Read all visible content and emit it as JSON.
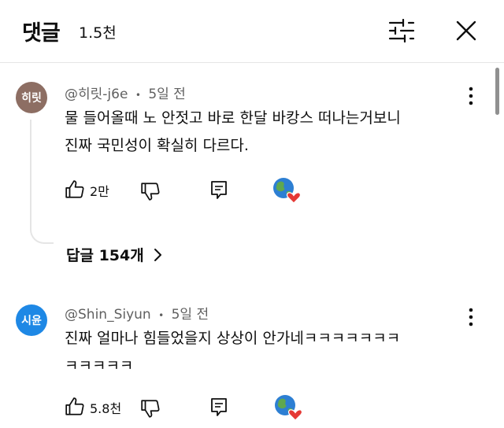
{
  "header": {
    "title": "댓글",
    "count": "1.5천"
  },
  "comments": [
    {
      "avatar_text": "히릿",
      "avatar_color": "#8d6e63",
      "handle": "@히릿-j6e",
      "time": "5일 전",
      "line1": "물 들어올때 노 안젓고 바로 한달 바캉스 떠나는거보니",
      "line2": "진짜 국민성이 확실히 다르다.",
      "likes": "2만",
      "replies_label": "답글 154개"
    },
    {
      "avatar_text": "시윤",
      "avatar_color": "#1e88e5",
      "handle": "@Shin_Siyun",
      "time": "5일 전",
      "line1": "진짜 얼마나 힘들었을지 상상이 안가네ㅋㅋㅋㅋㅋㅋㅋ",
      "line2": "ㅋㅋㅋㅋㅋ",
      "likes": "5.8천"
    }
  ],
  "separator": "•",
  "icons": {
    "filter": "sliders-icon",
    "close": "close-icon",
    "more": "more-vert-icon",
    "like": "thumbs-up-icon",
    "dislike": "thumbs-down-icon",
    "reply": "comment-icon",
    "creator_heart": "globe-heart-icon",
    "chevron": "chevron-right-icon"
  }
}
